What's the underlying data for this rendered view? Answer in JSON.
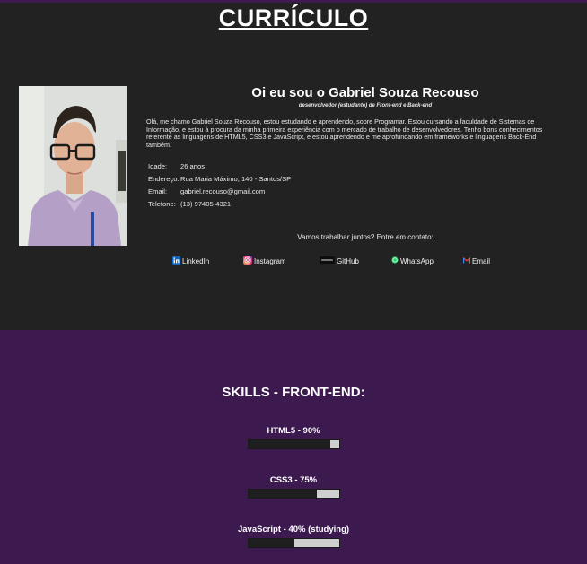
{
  "page": {
    "title": "CURRÍCULO"
  },
  "profile": {
    "photo_alt": "photo-of-gabriel",
    "heading": "Oi eu sou o Gabriel Souza Recouso",
    "subtitle": "desenvolvedor (estudante) de Front-end e Back-end",
    "bio": "Olá, me chamo Gabriel Souza Recouso, estou estudando e aprendendo, sobre Programar. Estou cursando a faculdade de Sistemas de Informação, e estou à procura da minha primeira experiência com o mercado de trabalho de desenvolvedores. Tenho bons conhecimentos referente as linguagens de HTML5, CSS3 e JavaScript, e estou aprendendo e me aprofundando em frameworks e linguagens Back-End também."
  },
  "info": [
    {
      "label": "Idade:",
      "value": "26 anos"
    },
    {
      "label": "Endereço:",
      "value": "Rua Maria Máximo, 140 - Santos/SP"
    },
    {
      "label": "Email:",
      "value": "gabriel.recouso@gmail.com"
    },
    {
      "label": "Telefone:",
      "value": "(13) 97405-4321"
    }
  ],
  "contact": {
    "invite": "Vamos trabalhar juntos? Entre em contato:",
    "links": [
      {
        "label": "LinkedIn",
        "icon": "linkedin-icon",
        "color": "#0a66c2"
      },
      {
        "label": "Instagram",
        "icon": "instagram-icon",
        "color": "#e1306c"
      },
      {
        "label": "GitHub",
        "icon": "github-icon",
        "color": "#111111"
      },
      {
        "label": "WhatsApp",
        "icon": "whatsapp-icon",
        "color": "#25d366"
      },
      {
        "label": "Email",
        "icon": "gmail-icon",
        "color": "#ea4335"
      }
    ]
  },
  "skills": {
    "title": "SKILLS - FRONT-END:",
    "items": [
      {
        "label": "HTML5 - 90%",
        "level": 0.9
      },
      {
        "label": "CSS3 - 75%",
        "level": 0.75
      },
      {
        "label": "JavaScript - 40% (studying)",
        "level": 0.5
      }
    ]
  },
  "colors": {
    "header_bg": "#222222",
    "skills_bg": "#3c1a4f",
    "bar_fill": "#1f1f1f",
    "bar_track": "#cfcfcf"
  }
}
